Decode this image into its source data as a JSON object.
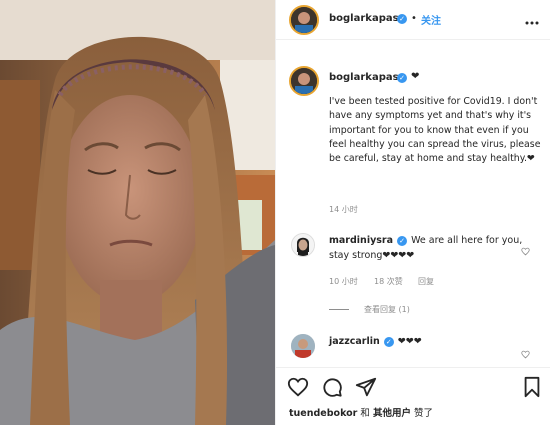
{
  "post": {
    "author": "boglarkapas",
    "follow_separator": "•",
    "follow_label": "关注",
    "more_icon": "more-horizontal-icon",
    "verified_mark": "✓",
    "caption_heart": "❤",
    "caption": "I've been tested positive for Covid19. I don't have any symptoms yet and that's why it's important for you to know that even if you feel healthy you can spread the virus, please be careful, stay at home and stay healthy.❤",
    "caption_time": "14 小时"
  },
  "comments": [
    {
      "user": "mardiniysra",
      "text": "We are all here for you, stay strong❤❤❤❤",
      "time": "10 小时",
      "likes": "18 次赞",
      "reply": "回复",
      "view_replies": "查看回复 (1)"
    },
    {
      "user": "jazzcarlin",
      "text": "❤❤❤"
    }
  ],
  "actions": {
    "like_icon": "heart-icon",
    "comment_icon": "comment-icon",
    "share_icon": "share-icon",
    "save_icon": "bookmark-icon"
  },
  "likes_line": {
    "user": "tuendebokor",
    "and": "和",
    "others": "其他用户",
    "liked": "赞了"
  },
  "colors": {
    "verified": "#3897f0",
    "story_ring": "#e8a531",
    "muted_text": "#8e8e8e",
    "divider": "#efefef"
  }
}
